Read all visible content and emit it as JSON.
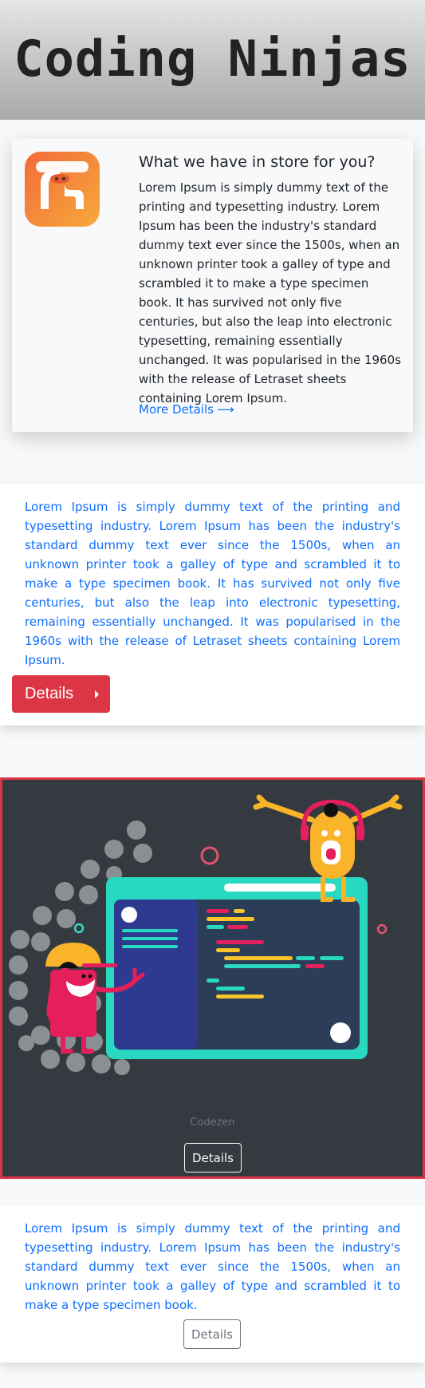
{
  "header": {
    "title": "Coding Ninjas"
  },
  "feature_card": {
    "heading": "What we have in store for you?",
    "body": "Lorem Ipsum is simply dummy text of the printing and typesetting industry. Lorem Ipsum has been the industry's standard dummy text ever since the 1500s, when an unknown printer took a galley of type and scrambled it to make a type specimen book. It has survived not only five centuries, but also the leap into electronic typesetting, remaining essentially unchanged. It was popularised in the 1960s with the release of Letraset sheets containing Lorem Ipsum.",
    "link_label": "More Details",
    "link_icon": "arrow-right-icon"
  },
  "section_two": {
    "body": "Lorem Ipsum is simply dummy text of the printing and typesetting industry. Lorem Ipsum has been the industry's standard dummy text ever since the 1500s, when an unknown printer took a galley of type and scrambled it to make a type specimen book. It has survived not only five centuries, but also the leap into electronic typesetting, remaining essentially unchanged. It was popularised in the 1960s with the release of Letraset sheets containing Lorem Ipsum.",
    "button_label": "Details"
  },
  "illustration_card": {
    "caption": "Codezen",
    "button_label": "Details"
  },
  "section_four": {
    "body": "Lorem Ipsum is simply dummy text of the printing and typesetting industry. Lorem Ipsum has been the industry's standard dummy text ever since the 1500s, when an unknown printer took a galley of type and scrambled it to make a type specimen book.",
    "button_label": "Details"
  },
  "colors": {
    "accent_red": "#dc3545",
    "link_blue": "#0d6efd",
    "dark_panel": "#343a40"
  }
}
